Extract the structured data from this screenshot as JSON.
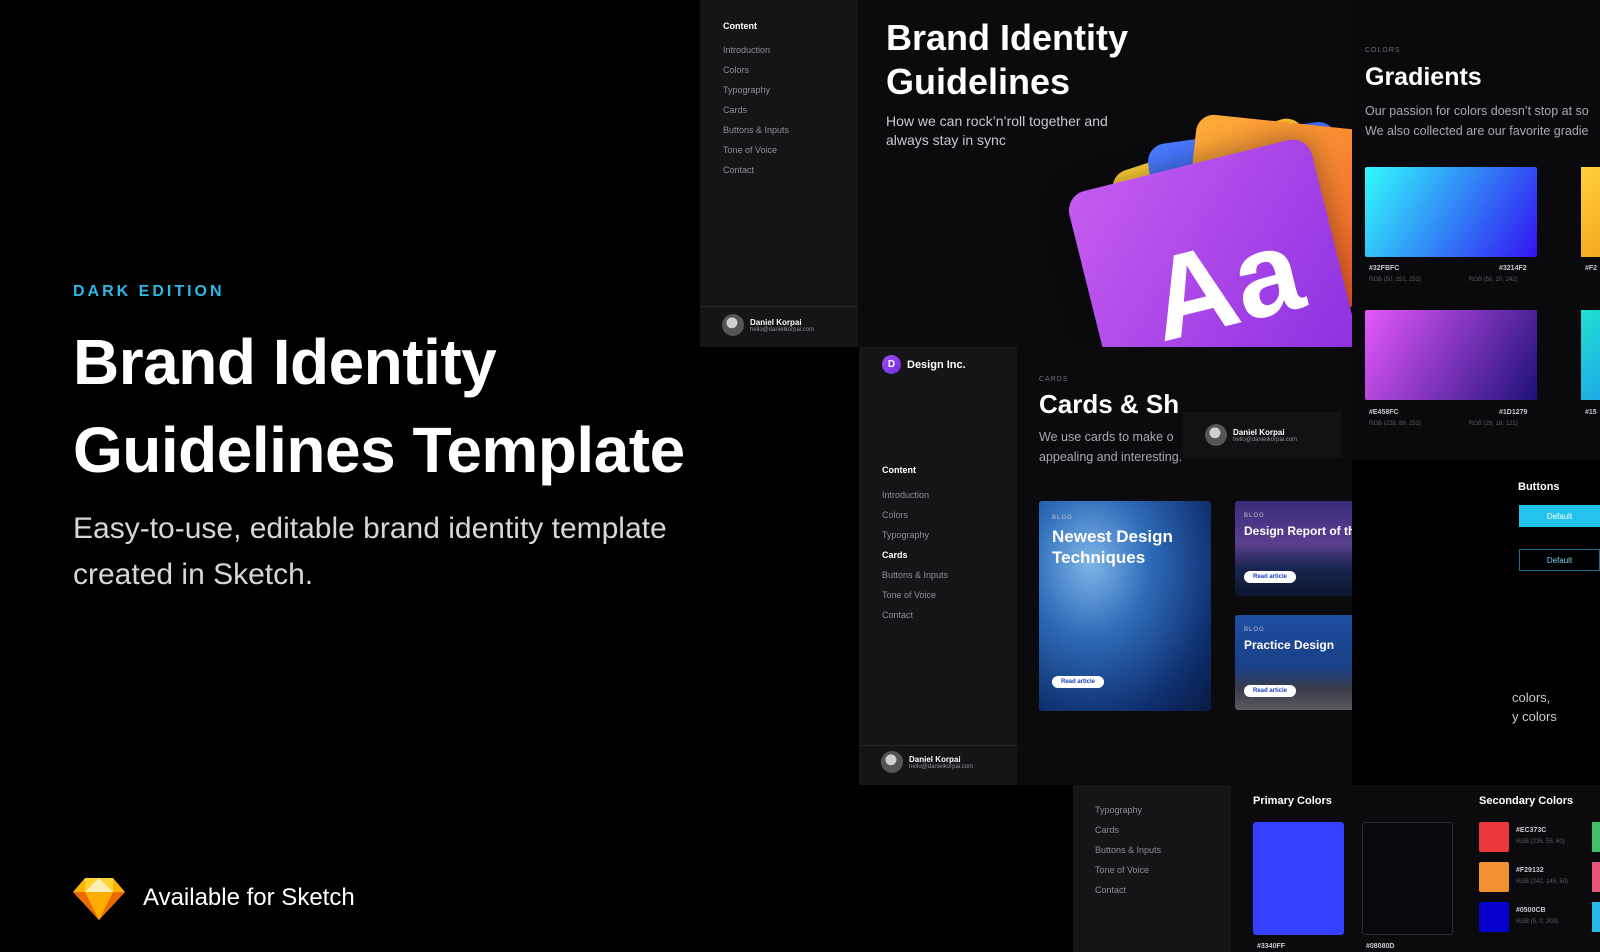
{
  "hero": {
    "kicker": "DARK EDITION",
    "title_line1": "Brand Identity",
    "title_line2": "Guidelines Template",
    "subtitle_line1": "Easy-to-use, editable brand identity template",
    "subtitle_line2": "created in Sketch.",
    "sketch_label": "Available for Sketch"
  },
  "nav": {
    "heading": "Content",
    "items": [
      "Introduction",
      "Colors",
      "Typography",
      "Cards",
      "Buttons & Inputs",
      "Tone of Voice",
      "Contact"
    ]
  },
  "author": {
    "name": "Daniel Korpai",
    "email": "hello@danielkorpai.com"
  },
  "intro_panel": {
    "title_line1": "Brand Identity",
    "title_line2": "Guidelines",
    "sub_line1": "How we can rock’n’roll together and",
    "sub_line2": "always stay in sync",
    "glyph": "Aa"
  },
  "gradients_panel": {
    "label": "COLORS",
    "title": "Gradients",
    "sub_line1": "Our passion for colors doesn’t stop at so",
    "sub_line2": "We also collected are our favorite gradie",
    "swatches": [
      {
        "hex_a": "#32FBFC",
        "hex_b": "#3214F2",
        "rgb_a": "RGB (50, 251, 252)",
        "rgb_b": "RGB (50, 20, 242)",
        "from": "#32FBFC",
        "to": "#3214F2"
      },
      {
        "hex_a": "#E458FC",
        "hex_b": "#1D1279",
        "rgb_a": "RGB (228, 88, 252)",
        "rgb_b": "RGB (29, 18, 121)",
        "from": "#E458FC",
        "to": "#1D1279"
      }
    ],
    "partial_hex_1": "#F2",
    "partial_hex_2": "#15"
  },
  "cards_panel": {
    "brand": "Design Inc.",
    "brand_initial": "D",
    "label": "CARDS",
    "title": "Cards & Sh",
    "sub_line1": "We use cards to make o",
    "sub_line2": "appealing and interesting.",
    "cards": [
      {
        "tag": "BLOG",
        "title": "Newest Design Techniques",
        "button": "Read article"
      },
      {
        "tag": "BLOG",
        "title": "Design Report of the Month",
        "button": "Read article"
      },
      {
        "tag": "BLOG",
        "title": "Practice Design",
        "button": "Read article"
      }
    ]
  },
  "buttons_panel": {
    "title": "Buttons",
    "fill_label": "Default",
    "outline_label": "Default",
    "fragment_line1": "colors,",
    "fragment_line2": "y colors"
  },
  "colors_panel": {
    "nav_items": [
      "Typography",
      "Cards",
      "Buttons & Inputs",
      "Tone of Voice",
      "Contact"
    ],
    "primary_title": "Primary Colors",
    "secondary_title": "Secondary Colors",
    "primary": [
      {
        "hex": "#3340FF",
        "color": "#3340FF"
      },
      {
        "hex": "#08080D",
        "color": "#08080D"
      }
    ],
    "secondary": [
      {
        "hex": "#EC373C",
        "rgb": "RGB (236, 55, 60)",
        "color": "#EC373C"
      },
      {
        "hex": "#F29132",
        "rgb": "RGB (242, 145, 50)",
        "color": "#F29132"
      },
      {
        "hex": "#0500CB",
        "rgb": "RGB (5, 0, 203)",
        "color": "#0500CB"
      }
    ]
  },
  "colors": {
    "accent": "#2FB7E6",
    "background": "#000000",
    "panel": "#151518"
  }
}
